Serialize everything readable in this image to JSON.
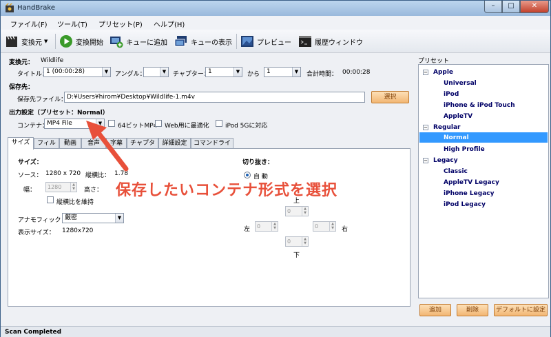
{
  "window": {
    "title": "HandBrake",
    "minimize_glyph": "–",
    "maximize_glyph": "□",
    "close_glyph": "✕"
  },
  "menu": [
    "ファイル(F)",
    "ツール(T)",
    "プリセット(P)",
    "ヘルプ(H)"
  ],
  "toolbar": {
    "source": "変換元",
    "start": "変換開始",
    "add_queue": "キューに追加",
    "show_queue": "キューの表示",
    "preview": "プレビュー",
    "activity_log": "履歴ウィンドウ"
  },
  "source": {
    "label": "変換元：",
    "value": "Wildlife",
    "title_label": "タイトル：",
    "title_value": "1 (00:00:28)",
    "angle_label": "アングル：",
    "angle_value": "",
    "chapter_label": "チャプター：",
    "chapter_from": "1",
    "to_label": "から",
    "chapter_to": "1",
    "duration_label": "合計時間：",
    "duration_value": "00:00:28"
  },
  "destination": {
    "section": "保存先：",
    "file_label": "保存先ファイル：",
    "file_value": "D:¥Users¥hirom¥Desktop¥Wildlife-1.m4v",
    "browse": "選択"
  },
  "output": {
    "section": "出力設定（プリセット：Normal）",
    "container_label": "コンテナ：",
    "container_value": "MP4 File",
    "opt_64bit": "64ビットMP4",
    "opt_web": "Web用に最適化",
    "opt_ipod": "iPod 5Gに対応"
  },
  "tabs": [
    "サイズ",
    "フィルタ",
    "動画",
    "音声",
    "字幕",
    "チャプター",
    "詳細設定",
    "コマンドライン"
  ],
  "size_tab": {
    "section": "サイズ：",
    "source_label": "ソース：",
    "source_value": "1280 x 720",
    "aspect_label": "縦横比：",
    "aspect_value": "1.78",
    "width_label": "幅：",
    "width_value": "1280",
    "height_label": "高さ：",
    "keep_aspect": "縦横比を維持",
    "anamorphic_label": "アナモフィック：",
    "anamorphic_value": "厳密",
    "display_label": "表示サイズ：",
    "display_value": "1280x720"
  },
  "cropping": {
    "section": "切り抜き：",
    "auto_label": "自 動",
    "top": "上",
    "left": "左",
    "right": "右",
    "bottom": "下",
    "top_value": "0",
    "left_value": "0",
    "right_value": "0",
    "bottom_value": "0"
  },
  "annotation": {
    "text": "保存したいコンテナ形式を選択",
    "color": "#e8503a"
  },
  "presets": {
    "title": "プリセット",
    "groups": [
      {
        "name": "Apple",
        "items": [
          "Universal",
          "iPod",
          "iPhone & iPod Touch",
          "AppleTV"
        ]
      },
      {
        "name": "Regular",
        "items": [
          "Normal",
          "High Profile"
        ]
      },
      {
        "name": "Legacy",
        "items": [
          "Classic",
          "AppleTV Legacy",
          "iPhone Legacy",
          "iPod Legacy"
        ]
      }
    ],
    "selected": "Normal",
    "add": "追加",
    "remove": "削除",
    "set_default": "デフォルトに設定"
  },
  "status": "Scan Completed",
  "colors": {
    "selection": "#3399ff",
    "preset_text": "#000066",
    "orange_button": "#f2b673"
  }
}
